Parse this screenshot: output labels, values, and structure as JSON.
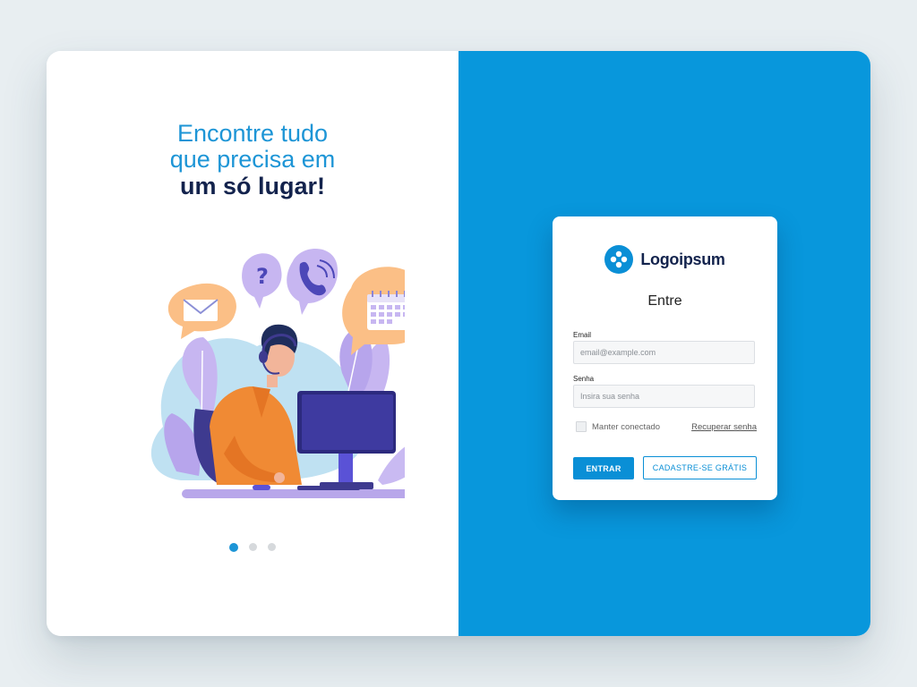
{
  "hero": {
    "line1": "Encontre tudo",
    "line2": "que precisa em",
    "line3": "um só lugar!"
  },
  "illustration": {
    "icons": [
      "envelope-icon",
      "question-icon",
      "phone-icon",
      "calendar-icon"
    ],
    "subject": "support-agent-at-computer"
  },
  "carousel": {
    "pages": 3,
    "active": 1
  },
  "login": {
    "brand": "Logoipsum",
    "title": "Entre",
    "email_label": "Email",
    "email_placeholder": "email@example.com",
    "password_label": "Senha",
    "password_placeholder": "Insira sua senha",
    "remember_label": "Manter conectado",
    "recover_label": "Recuperar senha",
    "submit_label": "ENTRAR",
    "signup_label": "CADASTRE-SE GRÁTIS"
  },
  "colors": {
    "background": "#e8eef1",
    "accent": "#0897dc",
    "headline": "#1d95d6",
    "headline_bold": "#13234d"
  }
}
